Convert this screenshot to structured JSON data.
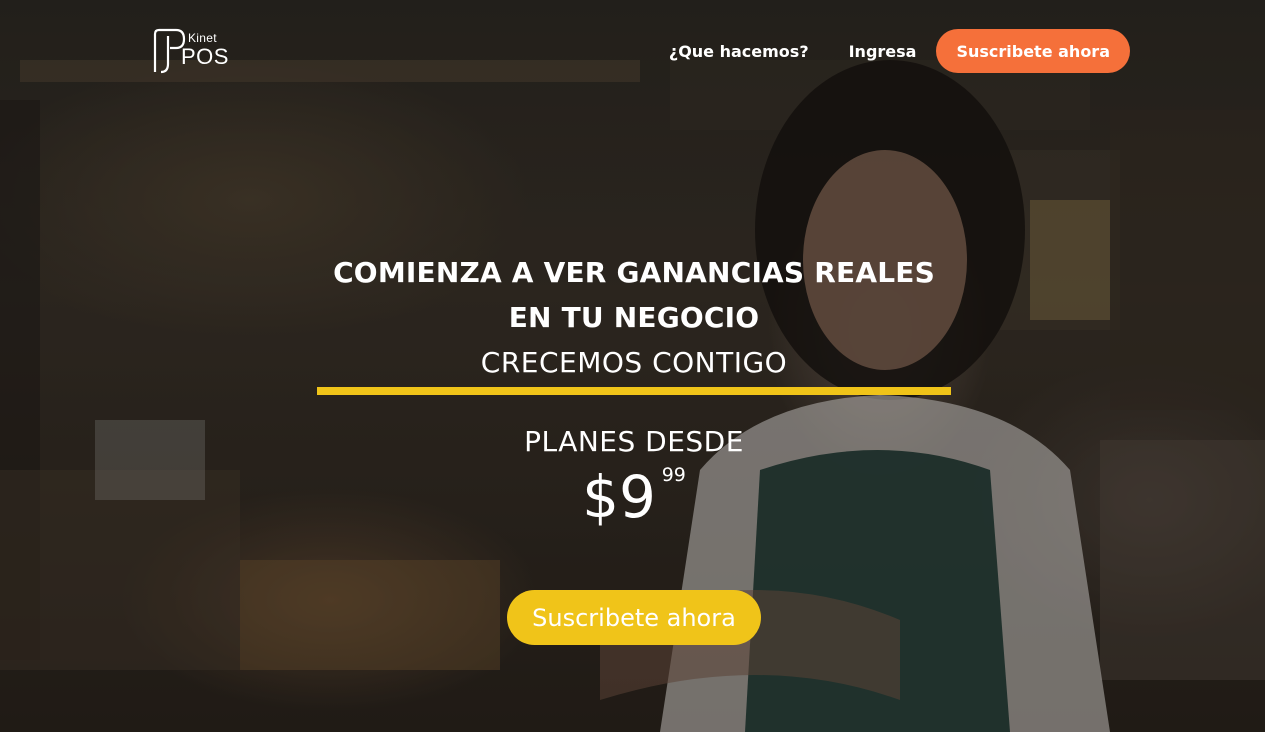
{
  "header": {
    "logo": {
      "kinet": "Kinet",
      "pos": "POS"
    },
    "nav": {
      "what_we_do": "¿Que hacemos?",
      "login": "Ingresa",
      "subscribe": "Suscribete ahora"
    }
  },
  "hero": {
    "headline": "COMIENZA A VER GANANCIAS REALES EN TU NEGOCIO",
    "subhead": "CRECEMOS CONTIGO",
    "plans_label": "PLANES DESDE",
    "price_main": "$9",
    "price_cents": "99",
    "cta": "Suscribete ahora"
  },
  "colors": {
    "accent_orange": "#f5703a",
    "accent_yellow": "#f0c419",
    "text": "#ffffff"
  },
  "icons": {
    "logo_mark": "kinet-pos-logo-icon"
  }
}
